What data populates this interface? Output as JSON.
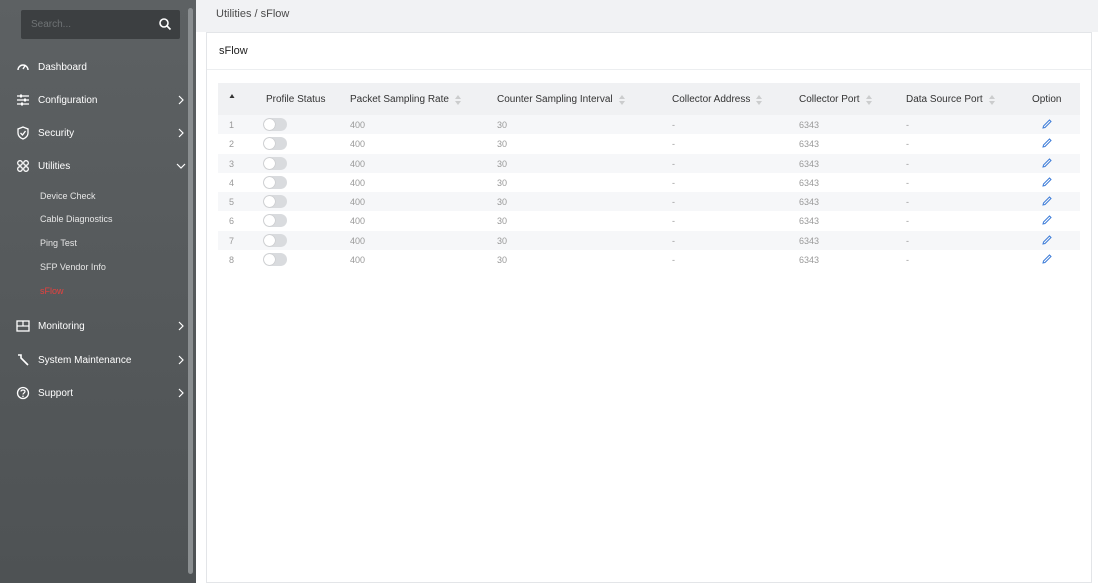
{
  "sidebar": {
    "search_placeholder": "Search...",
    "items": [
      {
        "label": "Dashboard",
        "icon": "dashboard-gauge-icon"
      },
      {
        "label": "Configuration",
        "icon": "sliders-icon"
      },
      {
        "label": "Security",
        "icon": "shield-icon"
      },
      {
        "label": "Utilities",
        "icon": "grid-icon"
      },
      {
        "label": "Monitoring",
        "icon": "monitor-icon"
      },
      {
        "label": "System Maintenance",
        "icon": "wrench-icon"
      },
      {
        "label": "Support",
        "icon": "help-icon"
      }
    ],
    "utilities_sub": [
      {
        "label": "Device Check"
      },
      {
        "label": "Cable Diagnostics"
      },
      {
        "label": "Ping Test"
      },
      {
        "label": "SFP Vendor Info"
      },
      {
        "label": "sFlow"
      }
    ]
  },
  "header": {
    "breadcrumb": "Utilities / sFlow"
  },
  "page": {
    "title": "sFlow"
  },
  "table": {
    "columns": [
      "Profile Status",
      "Packet Sampling Rate",
      "Counter Sampling Interval",
      "Collector Address",
      "Collector Port",
      "Data Source Port",
      "Option"
    ],
    "rows": [
      {
        "index": "1",
        "enabled": false,
        "rate": "400",
        "interval": "30",
        "address": "-",
        "port": "6343",
        "source": "-"
      },
      {
        "index": "2",
        "enabled": false,
        "rate": "400",
        "interval": "30",
        "address": "-",
        "port": "6343",
        "source": "-"
      },
      {
        "index": "3",
        "enabled": false,
        "rate": "400",
        "interval": "30",
        "address": "-",
        "port": "6343",
        "source": "-"
      },
      {
        "index": "4",
        "enabled": false,
        "rate": "400",
        "interval": "30",
        "address": "-",
        "port": "6343",
        "source": "-"
      },
      {
        "index": "5",
        "enabled": false,
        "rate": "400",
        "interval": "30",
        "address": "-",
        "port": "6343",
        "source": "-"
      },
      {
        "index": "6",
        "enabled": false,
        "rate": "400",
        "interval": "30",
        "address": "-",
        "port": "6343",
        "source": "-"
      },
      {
        "index": "7",
        "enabled": false,
        "rate": "400",
        "interval": "30",
        "address": "-",
        "port": "6343",
        "source": "-"
      },
      {
        "index": "8",
        "enabled": false,
        "rate": "400",
        "interval": "30",
        "address": "-",
        "port": "6343",
        "source": "-"
      }
    ]
  },
  "colors": {
    "accent_active": "#e8413e",
    "edit_icon": "#3b7bd8",
    "sidebar_bg": "#55595b"
  }
}
